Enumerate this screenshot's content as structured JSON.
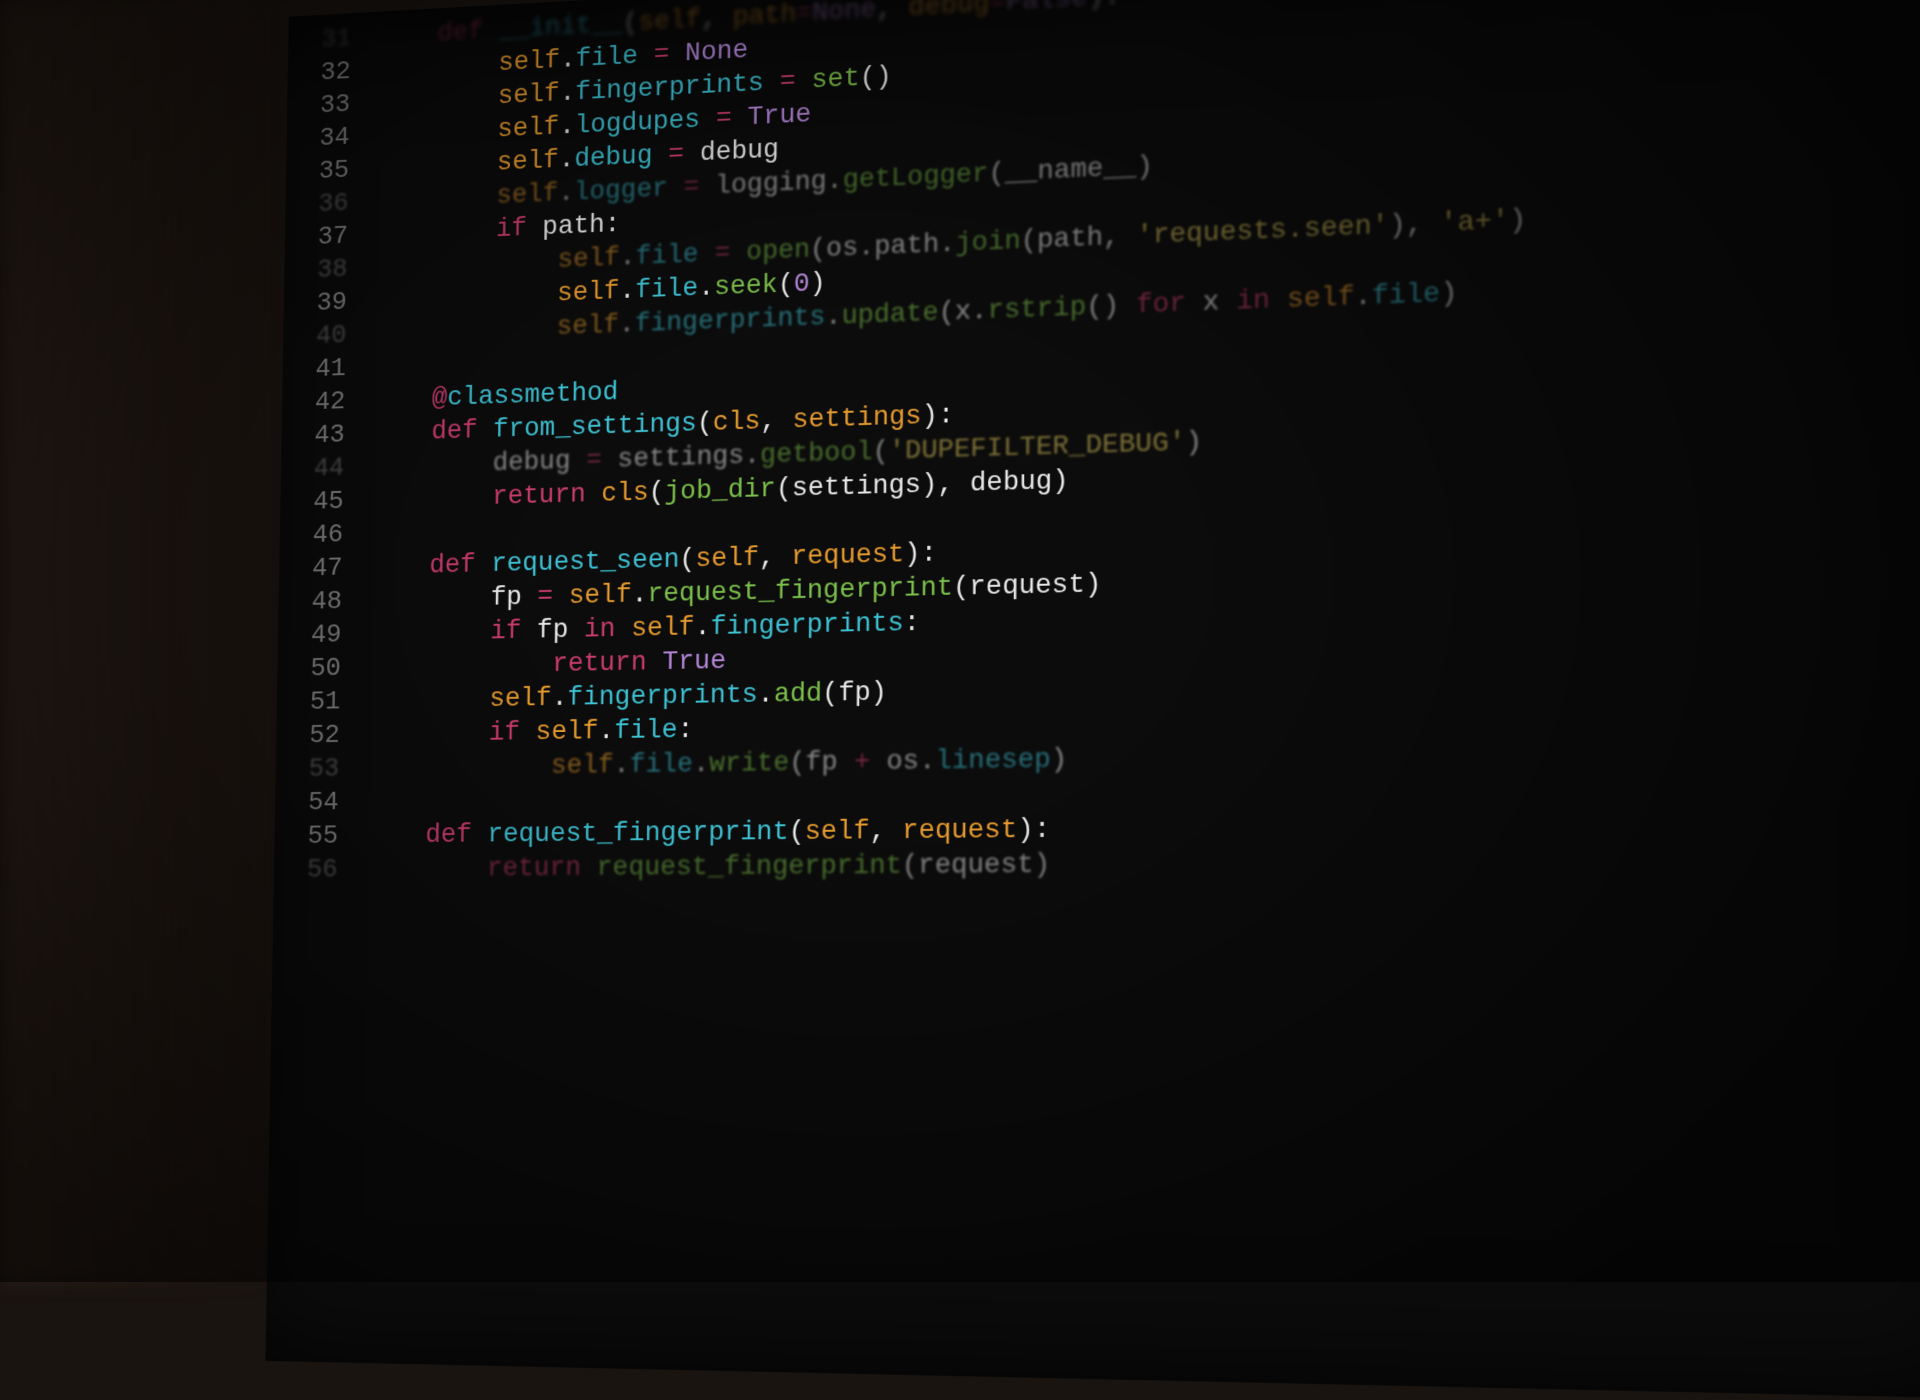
{
  "gutter_start": 31,
  "lines": [
    {
      "n": 31,
      "indent": 1,
      "cls": "dim2",
      "tokens": [
        [
          "kw",
          "def "
        ],
        [
          "fn",
          "__init__"
        ],
        [
          "pn",
          "("
        ],
        [
          "self",
          "self"
        ],
        [
          "pn",
          ", "
        ],
        [
          "param",
          "path"
        ],
        [
          "op",
          "="
        ],
        [
          "num",
          "None"
        ],
        [
          "pn",
          ", "
        ],
        [
          "param",
          "debug"
        ],
        [
          "op",
          "="
        ],
        [
          "num",
          "False"
        ],
        [
          "pn",
          "):"
        ]
      ]
    },
    {
      "n": 32,
      "indent": 2,
      "cls": "",
      "tokens": [
        [
          "self",
          "self"
        ],
        [
          "pn",
          "."
        ],
        [
          "fn",
          "file"
        ],
        [
          "pn",
          " "
        ],
        [
          "op",
          "="
        ],
        [
          "pn",
          " "
        ],
        [
          "num",
          "None"
        ]
      ]
    },
    {
      "n": 33,
      "indent": 2,
      "cls": "",
      "tokens": [
        [
          "self",
          "self"
        ],
        [
          "pn",
          "."
        ],
        [
          "fn",
          "fingerprints"
        ],
        [
          "pn",
          " "
        ],
        [
          "op",
          "="
        ],
        [
          "pn",
          " "
        ],
        [
          "fn2",
          "set"
        ],
        [
          "pn",
          "()"
        ]
      ]
    },
    {
      "n": 34,
      "indent": 2,
      "cls": "",
      "tokens": [
        [
          "self",
          "self"
        ],
        [
          "pn",
          "."
        ],
        [
          "fn",
          "logdupes"
        ],
        [
          "pn",
          " "
        ],
        [
          "op",
          "="
        ],
        [
          "pn",
          " "
        ],
        [
          "num",
          "True"
        ]
      ]
    },
    {
      "n": 35,
      "indent": 2,
      "cls": "",
      "tokens": [
        [
          "self",
          "self"
        ],
        [
          "pn",
          "."
        ],
        [
          "fn",
          "debug"
        ],
        [
          "pn",
          " "
        ],
        [
          "op",
          "="
        ],
        [
          "pn",
          " "
        ],
        [
          "pn",
          "debug"
        ]
      ]
    },
    {
      "n": 36,
      "indent": 2,
      "cls": "dim",
      "tokens": [
        [
          "self",
          "self"
        ],
        [
          "pn",
          "."
        ],
        [
          "fn",
          "logger"
        ],
        [
          "pn",
          " "
        ],
        [
          "op",
          "="
        ],
        [
          "pn",
          " "
        ],
        [
          "pn",
          "logging."
        ],
        [
          "fn2",
          "getLogger"
        ],
        [
          "pn",
          "("
        ],
        [
          "pn",
          "__name__"
        ],
        [
          "pn",
          ")"
        ]
      ]
    },
    {
      "n": 37,
      "indent": 2,
      "cls": "",
      "tokens": [
        [
          "kw",
          "if "
        ],
        [
          "pn",
          "path:"
        ]
      ]
    },
    {
      "n": 38,
      "indent": 3,
      "cls": "dim",
      "tokens": [
        [
          "self",
          "self"
        ],
        [
          "pn",
          "."
        ],
        [
          "fn",
          "file"
        ],
        [
          "pn",
          " "
        ],
        [
          "op",
          "="
        ],
        [
          "pn",
          " "
        ],
        [
          "fn2",
          "open"
        ],
        [
          "pn",
          "(os.path."
        ],
        [
          "fn2",
          "join"
        ],
        [
          "pn",
          "(path, "
        ],
        [
          "str",
          "'requests.seen'"
        ],
        [
          "pn",
          "), "
        ],
        [
          "str",
          "'a+'"
        ],
        [
          "pn",
          ")"
        ]
      ]
    },
    {
      "n": 39,
      "indent": 3,
      "cls": "",
      "tokens": [
        [
          "self",
          "self"
        ],
        [
          "pn",
          "."
        ],
        [
          "fn",
          "file"
        ],
        [
          "pn",
          "."
        ],
        [
          "fn2",
          "seek"
        ],
        [
          "pn",
          "("
        ],
        [
          "num",
          "0"
        ],
        [
          "pn",
          ")"
        ]
      ]
    },
    {
      "n": 40,
      "indent": 3,
      "cls": "dim",
      "tokens": [
        [
          "self",
          "self"
        ],
        [
          "pn",
          "."
        ],
        [
          "fn",
          "fingerprints"
        ],
        [
          "pn",
          "."
        ],
        [
          "fn2",
          "update"
        ],
        [
          "pn",
          "(x."
        ],
        [
          "fn2",
          "rstrip"
        ],
        [
          "pn",
          "() "
        ],
        [
          "kw",
          "for"
        ],
        [
          "pn",
          " x "
        ],
        [
          "kw",
          "in"
        ],
        [
          "pn",
          " "
        ],
        [
          "self",
          "self"
        ],
        [
          "pn",
          "."
        ],
        [
          "fn",
          "file"
        ],
        [
          "pn",
          ")"
        ]
      ]
    },
    {
      "n": 41,
      "indent": 0,
      "cls": "",
      "tokens": []
    },
    {
      "n": 42,
      "indent": 1,
      "cls": "",
      "tokens": [
        [
          "at",
          "@"
        ],
        [
          "dec",
          "classmethod"
        ]
      ]
    },
    {
      "n": 43,
      "indent": 1,
      "cls": "",
      "tokens": [
        [
          "kw",
          "def "
        ],
        [
          "fn",
          "from_settings"
        ],
        [
          "pn",
          "("
        ],
        [
          "self",
          "cls"
        ],
        [
          "pn",
          ", "
        ],
        [
          "param",
          "settings"
        ],
        [
          "pn",
          "):"
        ]
      ]
    },
    {
      "n": 44,
      "indent": 2,
      "cls": "dim",
      "tokens": [
        [
          "pn",
          "debug "
        ],
        [
          "op",
          "="
        ],
        [
          "pn",
          " settings."
        ],
        [
          "fn2",
          "getbool"
        ],
        [
          "pn",
          "("
        ],
        [
          "str",
          "'DUPEFILTER_DEBUG'"
        ],
        [
          "pn",
          ")"
        ]
      ]
    },
    {
      "n": 45,
      "indent": 2,
      "cls": "",
      "tokens": [
        [
          "kw",
          "return "
        ],
        [
          "self",
          "cls"
        ],
        [
          "pn",
          "("
        ],
        [
          "fn2",
          "job_dir"
        ],
        [
          "pn",
          "(settings), "
        ],
        [
          "pn",
          "debug)"
        ]
      ]
    },
    {
      "n": 46,
      "indent": 0,
      "cls": "",
      "tokens": []
    },
    {
      "n": 47,
      "indent": 1,
      "cls": "",
      "tokens": [
        [
          "kw",
          "def "
        ],
        [
          "fn",
          "request_seen"
        ],
        [
          "pn",
          "("
        ],
        [
          "self",
          "self"
        ],
        [
          "pn",
          ", "
        ],
        [
          "param",
          "request"
        ],
        [
          "pn",
          "):"
        ]
      ]
    },
    {
      "n": 48,
      "indent": 2,
      "cls": "",
      "tokens": [
        [
          "pn",
          "fp "
        ],
        [
          "op",
          "="
        ],
        [
          "pn",
          " "
        ],
        [
          "self",
          "self"
        ],
        [
          "pn",
          "."
        ],
        [
          "fn2",
          "request_fingerprint"
        ],
        [
          "pn",
          "(request)"
        ]
      ]
    },
    {
      "n": 49,
      "indent": 2,
      "cls": "",
      "tokens": [
        [
          "kw",
          "if "
        ],
        [
          "pn",
          "fp "
        ],
        [
          "kw",
          "in "
        ],
        [
          "self",
          "self"
        ],
        [
          "pn",
          "."
        ],
        [
          "fn",
          "fingerprints"
        ],
        [
          "pn",
          ":"
        ]
      ]
    },
    {
      "n": 50,
      "indent": 3,
      "cls": "",
      "tokens": [
        [
          "kw",
          "return "
        ],
        [
          "num",
          "True"
        ]
      ]
    },
    {
      "n": 51,
      "indent": 2,
      "cls": "",
      "tokens": [
        [
          "self",
          "self"
        ],
        [
          "pn",
          "."
        ],
        [
          "fn",
          "fingerprints"
        ],
        [
          "pn",
          "."
        ],
        [
          "fn2",
          "add"
        ],
        [
          "pn",
          "(fp)"
        ]
      ]
    },
    {
      "n": 52,
      "indent": 2,
      "cls": "",
      "tokens": [
        [
          "kw",
          "if "
        ],
        [
          "self",
          "self"
        ],
        [
          "pn",
          "."
        ],
        [
          "fn",
          "file"
        ],
        [
          "pn",
          ":"
        ]
      ]
    },
    {
      "n": 53,
      "indent": 3,
      "cls": "dim",
      "tokens": [
        [
          "self",
          "self"
        ],
        [
          "pn",
          "."
        ],
        [
          "fn",
          "file"
        ],
        [
          "pn",
          "."
        ],
        [
          "fn2",
          "write"
        ],
        [
          "pn",
          "(fp "
        ],
        [
          "op",
          "+"
        ],
        [
          "pn",
          " os."
        ],
        [
          "fn",
          "linesep"
        ],
        [
          "pn",
          ")"
        ]
      ]
    },
    {
      "n": 54,
      "indent": 0,
      "cls": "",
      "tokens": []
    },
    {
      "n": 55,
      "indent": 1,
      "cls": "",
      "tokens": [
        [
          "kw",
          "def "
        ],
        [
          "fn",
          "request_fingerprint"
        ],
        [
          "pn",
          "("
        ],
        [
          "self",
          "self"
        ],
        [
          "pn",
          ", "
        ],
        [
          "param",
          "request"
        ],
        [
          "pn",
          "):"
        ]
      ]
    },
    {
      "n": 56,
      "indent": 2,
      "cls": "dim",
      "tokens": [
        [
          "kw",
          "return "
        ],
        [
          "fn2",
          "request_fingerprint"
        ],
        [
          "pn",
          "(request)"
        ]
      ]
    }
  ]
}
